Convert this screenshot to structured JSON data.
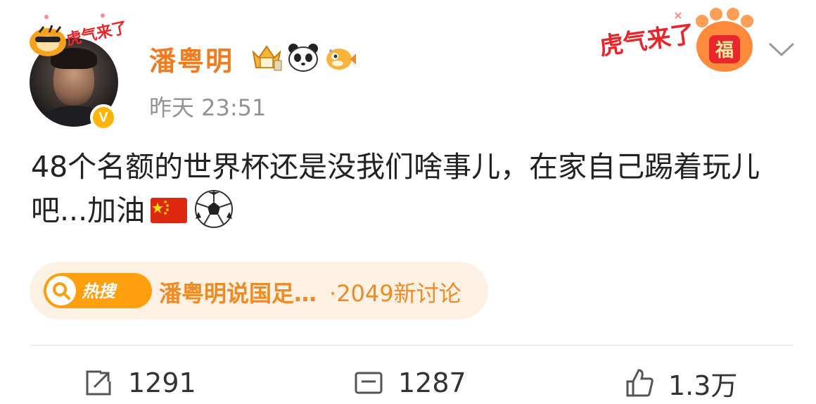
{
  "post": {
    "author": {
      "name": "潘粤明",
      "verified_mark": "V",
      "avatar_deco_text": "虎气来了",
      "badge_icons": [
        "crown-badge-icon",
        "panda-icon",
        "pufferfish-icon"
      ]
    },
    "timestamp": "昨天 23:51",
    "header_deco": {
      "text": "虎气来了",
      "paw_text": "福"
    },
    "content_text": "48个名额的世界杯还是没我们啥事儿，在家自己踢着玩儿吧...加油",
    "content_emojis": [
      "china-flag-icon",
      "soccer-ball-icon"
    ],
    "hot_search": {
      "badge_label": "热搜",
      "topic": "潘粤明说国足…",
      "count": "·2049新讨论"
    },
    "actions": {
      "repost_count": "1291",
      "comment_count": "1287",
      "like_count": "1.3万"
    }
  },
  "colors": {
    "username": "#f27b1f",
    "timestamp": "#939393",
    "hot_pill_bg": "#fdf1e3",
    "hot_badge": "#ff9f0e",
    "verified_badge": "#ffb400"
  }
}
